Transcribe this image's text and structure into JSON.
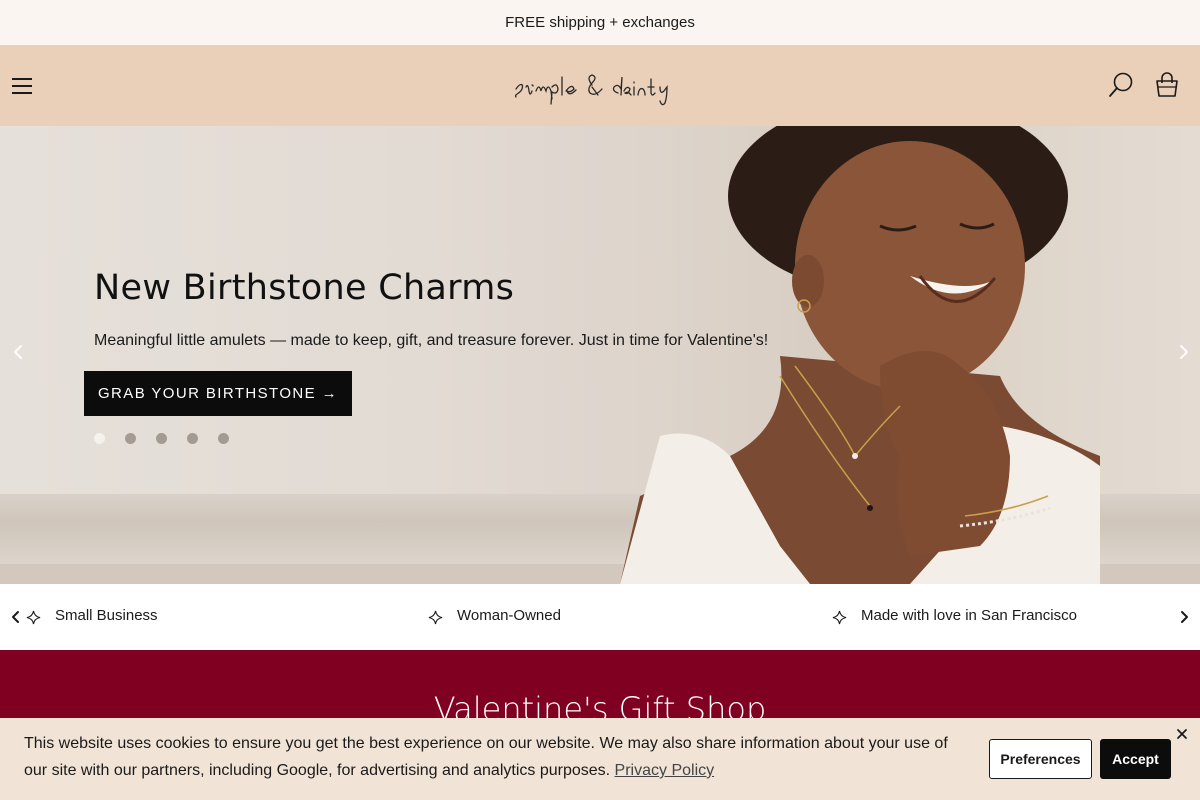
{
  "announcement": {
    "text": "FREE shipping + exchanges"
  },
  "header": {
    "logo_text": "simple & dainty",
    "menu_icon": "hamburger-menu-icon",
    "search_icon": "search-icon",
    "cart_icon": "shopping-bag-icon"
  },
  "hero": {
    "title": "New Birthstone Charms",
    "subtitle": "Meaningful little amulets — made to keep, gift, and treasure forever. Just in time for Valentine's!",
    "cta_label": "GRAB YOUR BIRTHSTONE →",
    "slide_count": 5,
    "active_slide": 1
  },
  "trust_bar": {
    "items": [
      {
        "label": "Small Business"
      },
      {
        "label": "Woman-Owned"
      },
      {
        "label": "Made with love in San Francisco"
      }
    ]
  },
  "valentine": {
    "title": "Valentine's Gift Shop"
  },
  "cookie_banner": {
    "text": "This website uses cookies to ensure you get the best experience on our website. We may also share information about your use of our site with our partners, including Google, for advertising and analytics purposes.",
    "policy_link": "Privacy Policy",
    "preferences_label": "Preferences",
    "accept_label": "Accept"
  },
  "colors": {
    "announcement_bg": "#faf5f1",
    "header_bg": "#ead0b8",
    "cta_bg": "#0c0c0c",
    "valentine_bg": "#7f0020",
    "cookie_bg": "#f1e4d7"
  }
}
